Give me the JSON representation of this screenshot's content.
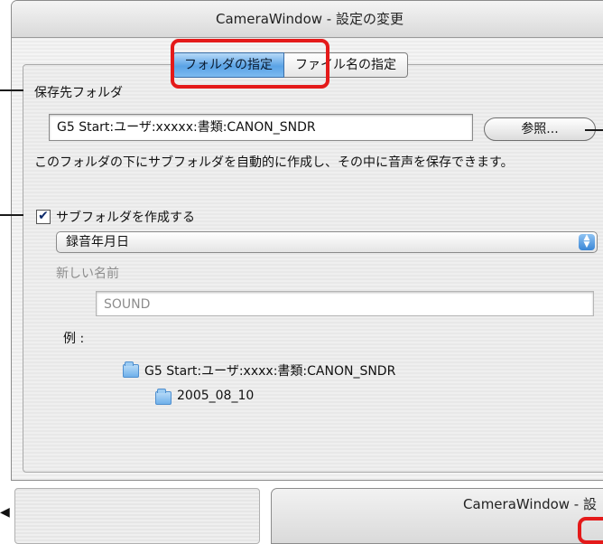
{
  "window": {
    "title": "CameraWindow - 設定の変更"
  },
  "tabs": [
    {
      "label": "フォルダの指定",
      "active": true
    },
    {
      "label": "ファイル名の指定",
      "active": false
    }
  ],
  "highlight_color": "#e41a1a",
  "save_folder": {
    "heading": "保存先フォルダ",
    "path_value": "G5 Start:ユーザ:xxxxx:書類:CANON_SNDR",
    "browse_button": "参照...",
    "description": "このフォルダの下にサブフォルダを自動的に作成し、その中に音声を保存できます。"
  },
  "subfolder": {
    "checkbox_label": "サブフォルダを作成する",
    "checked": true,
    "popup_value": "録音年月日",
    "new_name_label": "新しい名前",
    "new_name_value": "SOUND",
    "example_label": "例 :",
    "example_parent": "G5 Start:ユーザ:xxxx:書類:CANON_SNDR",
    "example_child": "2005_08_10"
  },
  "second_window": {
    "title": "CameraWindow - 設"
  }
}
